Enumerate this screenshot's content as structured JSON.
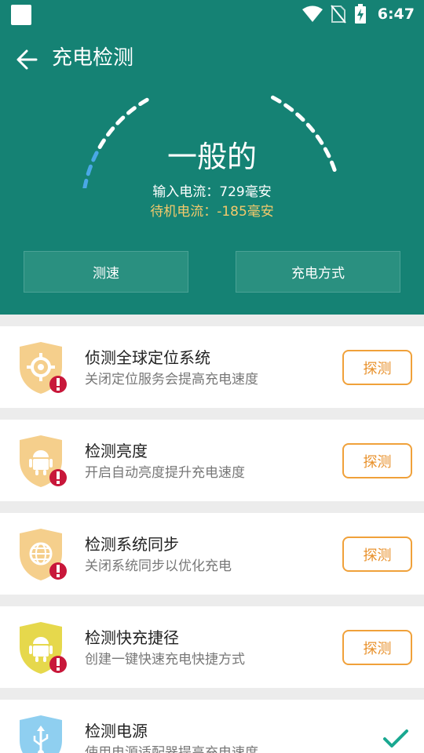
{
  "status_bar": {
    "time": "6:47"
  },
  "app": {
    "title": "充电检测"
  },
  "gauge": {
    "status": "一般的",
    "input_current": "输入电流：729毫安",
    "standby_current": "待机电流：-185毫安"
  },
  "buttons": {
    "speed": "测速",
    "mode": "充电方式"
  },
  "items": [
    {
      "title": "侦测全球定位系统",
      "desc": "关闭定位服务会提高充电速度",
      "action": "探测",
      "icon": "location-shield-icon"
    },
    {
      "title": "检测亮度",
      "desc": "开启自动亮度提升充电速度",
      "action": "探测",
      "icon": "android-shield-icon"
    },
    {
      "title": "检测系统同步",
      "desc": "关闭系统同步以优化充电",
      "action": "探测",
      "icon": "globe-shield-icon"
    },
    {
      "title": "检测快充捷径",
      "desc": "创建一键快速充电快捷方式",
      "action": "探测",
      "icon": "android-shield-icon"
    },
    {
      "title": "检测电源",
      "desc": "使用电源适配器提高充电速度",
      "action": "",
      "icon": "usb-shield-icon"
    }
  ],
  "colors": {
    "header": "#158274",
    "accent_orange": "#f0a13a",
    "alert_red": "#c8173a",
    "check_teal": "#1aa891"
  }
}
